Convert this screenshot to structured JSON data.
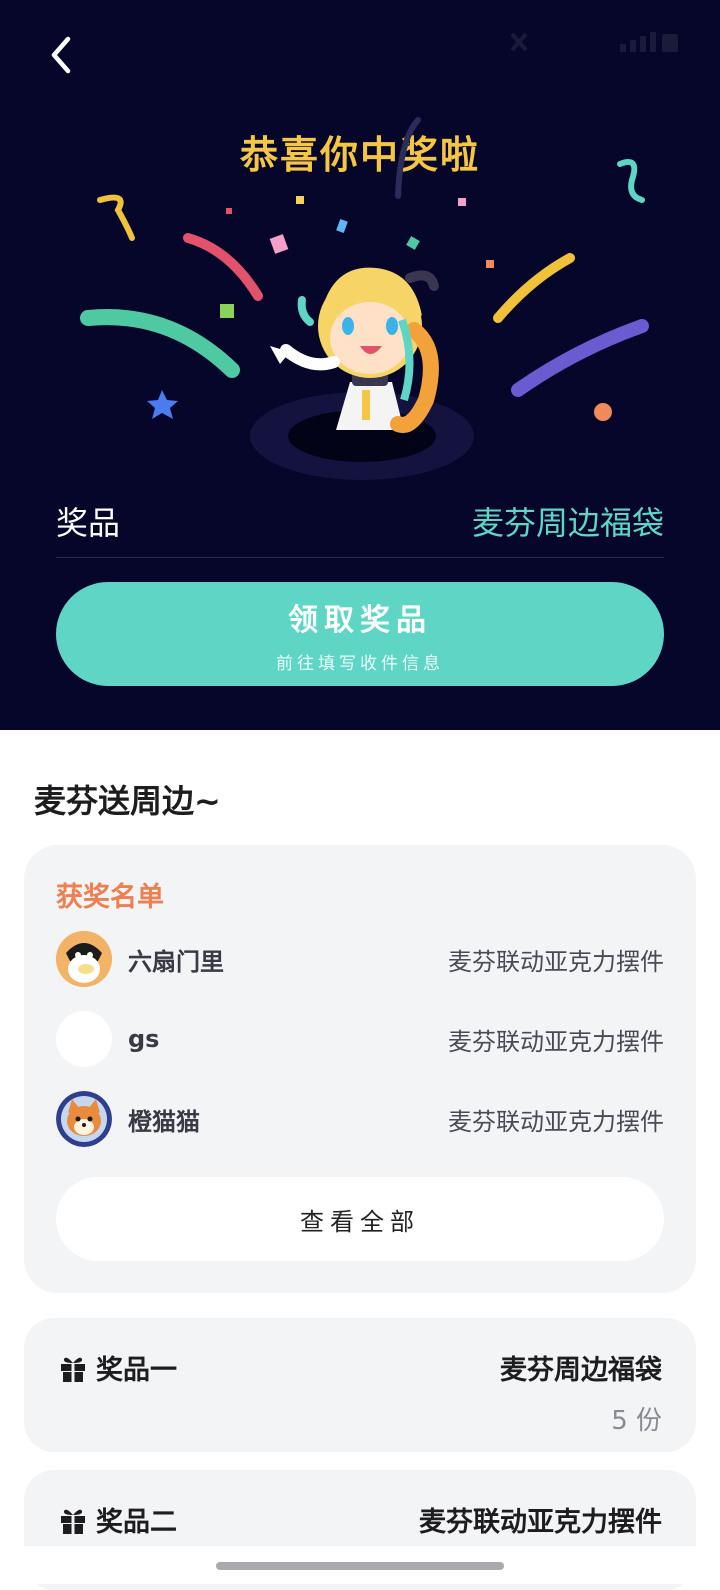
{
  "hero": {
    "title": "恭喜你中奖啦",
    "prize_label": "奖品",
    "prize_value": "麦芬周边福袋",
    "claim_button": "领取奖品",
    "claim_sub": "前往填写收件信息"
  },
  "section": {
    "title": "麦芬送周边~"
  },
  "winners": {
    "label": "获奖名单",
    "items": [
      {
        "name": "六扇门里",
        "prize": "麦芬联动亚克力摆件"
      },
      {
        "name": "gs",
        "prize": "麦芬联动亚克力摆件"
      },
      {
        "name": "橙猫猫",
        "prize": "麦芬联动亚克力摆件"
      }
    ],
    "view_all": "查看全部"
  },
  "prizes": [
    {
      "label": "奖品一",
      "name": "麦芬周边福袋",
      "qty": "5 份"
    },
    {
      "label": "奖品二",
      "name": "麦芬联动亚克力摆件"
    }
  ],
  "colors": {
    "hero_bg": "#06062b",
    "title_gold": "#f5c544",
    "accent_teal": "#5fd6c5",
    "winner_label": "#ef7f4f"
  }
}
